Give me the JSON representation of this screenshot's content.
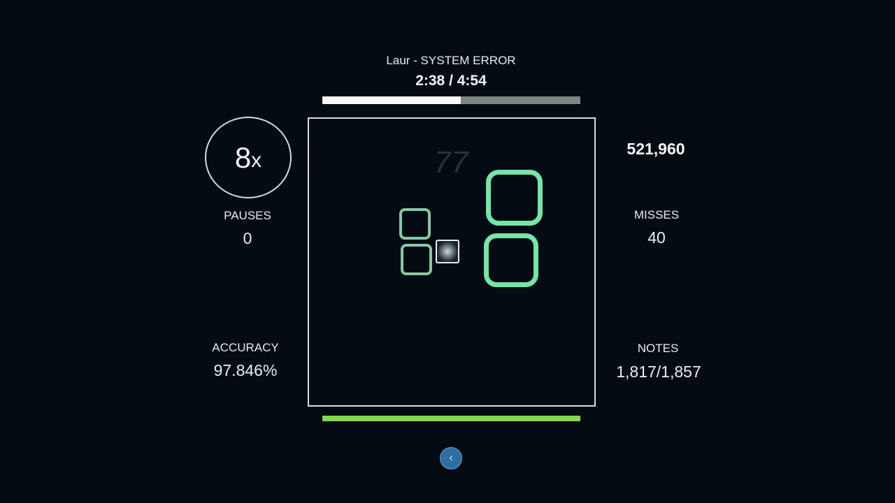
{
  "song": {
    "title": "Laur - SYSTEM ERROR",
    "time": "2:38 / 4:54",
    "progress": 0.537
  },
  "multiplier": {
    "value": "8",
    "suffix": "x"
  },
  "score": "521,960",
  "stats": {
    "pauses": {
      "label": "PAUSES",
      "value": "0"
    },
    "misses": {
      "label": "MISSES",
      "value": "40"
    },
    "accuracy": {
      "label": "ACCURACY",
      "value": "97.846%"
    },
    "notes": {
      "label": "NOTES",
      "value": "1,817/1,857"
    }
  },
  "combo": "77",
  "health": 1.0,
  "colors": {
    "background": "#050b12",
    "note_small": "#86c8a6",
    "note_big": "#73e6a8",
    "health_bar": "#84d84a",
    "back_button": "#2d6fa0"
  },
  "icons": {
    "back": "chevron-left-icon"
  }
}
